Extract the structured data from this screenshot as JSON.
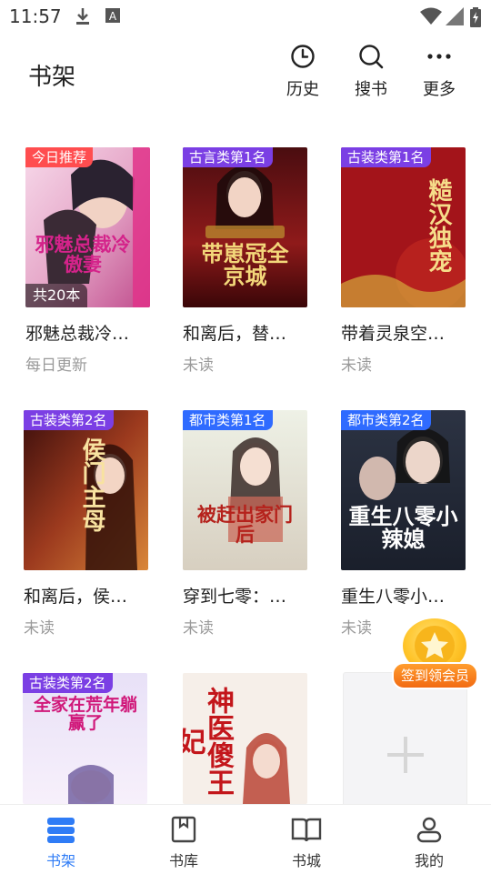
{
  "status_bar": {
    "time": "11:57",
    "icons": [
      "download-icon",
      "app-notification-icon",
      "wifi-icon",
      "signal-icon",
      "battery-charging-icon"
    ]
  },
  "header": {
    "title": "书架",
    "actions": [
      {
        "label": "历史",
        "icon": "clock-icon"
      },
      {
        "label": "搜书",
        "icon": "search-icon"
      },
      {
        "label": "更多",
        "icon": "more-icon"
      }
    ]
  },
  "books": [
    {
      "title": "邪魅总裁冷…",
      "status": "每日更新",
      "tag": "今日推荐",
      "tag_color": "#ff4d4f",
      "count": "共20本",
      "cover_text": "邪魅总裁冷傲妻"
    },
    {
      "title": "和离后，替…",
      "status": "未读",
      "tag": "古言类第1名",
      "tag_color": "#7b3fe4",
      "cover_text": "带崽冠全京城"
    },
    {
      "title": "带着灵泉空…",
      "status": "未读",
      "tag": "古装类第1名",
      "tag_color": "#7b3fe4",
      "cover_text": "糙汉独宠"
    },
    {
      "title": "和离后，侯…",
      "status": "未读",
      "tag": "古装类第2名",
      "tag_color": "#7b3fe4",
      "cover_text": "侯门主母"
    },
    {
      "title": "穿到七零：…",
      "status": "未读",
      "tag": "都市类第1名",
      "tag_color": "#2f6bff",
      "cover_text": "被赶出家门后"
    },
    {
      "title": "重生八零小…",
      "status": "未读",
      "tag": "都市类第2名",
      "tag_color": "#2f6bff",
      "cover_text": "重生八零小辣媳"
    },
    {
      "title": "",
      "status": "",
      "tag": "古装类第2名",
      "tag_color": "#7b3fe4",
      "cover_text": "全家在荒年躺赢了"
    },
    {
      "title": "",
      "status": "",
      "tag": "",
      "tag_color": "",
      "cover_text": "神医傻王妃"
    }
  ],
  "signin_float": {
    "label": "签到领会员"
  },
  "bottom_nav": [
    {
      "label": "书架",
      "icon": "bookshelf-icon",
      "active": true
    },
    {
      "label": "书库",
      "icon": "book-library-icon",
      "active": false
    },
    {
      "label": "书城",
      "icon": "open-book-icon",
      "active": false
    },
    {
      "label": "我的",
      "icon": "profile-icon",
      "active": false
    }
  ],
  "colors": {
    "accent": "#2f7cf6",
    "muted_text": "#9a9a9a"
  }
}
